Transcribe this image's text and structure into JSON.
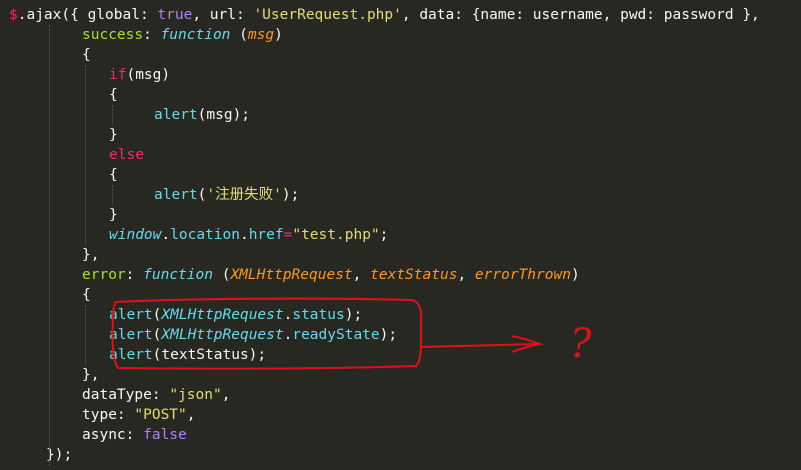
{
  "editor": {
    "lines": [
      {
        "indent": 0,
        "tokens": [
          {
            "t": "$",
            "c": "kw"
          },
          {
            "t": ".ajax({ global: ",
            "c": "pl"
          },
          {
            "t": "true",
            "c": "cn"
          },
          {
            "t": ", url: ",
            "c": "pl"
          },
          {
            "t": "'UserRequest.php'",
            "c": "st"
          },
          {
            "t": ", data: {name: username, pwd: password },",
            "c": "pl"
          }
        ]
      },
      {
        "indent": 1,
        "tokens": [
          {
            "t": "success",
            "c": "fn"
          },
          {
            "t": ": ",
            "c": "pl"
          },
          {
            "t": "function",
            "c": "kwi"
          },
          {
            "t": " (",
            "c": "pl"
          },
          {
            "t": "msg",
            "c": "pa"
          },
          {
            "t": ")",
            "c": "pl"
          }
        ]
      },
      {
        "indent": 1,
        "tokens": [
          {
            "t": "{",
            "c": "pl"
          }
        ]
      },
      {
        "indent": 2,
        "tokens": [
          {
            "t": "if",
            "c": "kw"
          },
          {
            "t": "(msg)",
            "c": "pl"
          }
        ]
      },
      {
        "indent": 2,
        "tokens": [
          {
            "t": "{",
            "c": "pl"
          }
        ]
      },
      {
        "indent": 3,
        "tokens": [
          {
            "t": "alert",
            "c": "ob"
          },
          {
            "t": "(msg);",
            "c": "pl"
          }
        ]
      },
      {
        "indent": 2,
        "tokens": [
          {
            "t": "}",
            "c": "pl"
          }
        ]
      },
      {
        "indent": 2,
        "tokens": [
          {
            "t": "else",
            "c": "kw"
          }
        ]
      },
      {
        "indent": 2,
        "tokens": [
          {
            "t": "{",
            "c": "pl"
          }
        ]
      },
      {
        "indent": 3,
        "tokens": [
          {
            "t": "alert",
            "c": "ob"
          },
          {
            "t": "(",
            "c": "pl"
          },
          {
            "t": "'注册失败'",
            "c": "st"
          },
          {
            "t": ");",
            "c": "pl"
          }
        ]
      },
      {
        "indent": 2,
        "tokens": [
          {
            "t": "}",
            "c": "pl"
          }
        ]
      },
      {
        "indent": 2,
        "tokens": [
          {
            "t": "window",
            "c": "id"
          },
          {
            "t": ".",
            "c": "pl"
          },
          {
            "t": "location",
            "c": "ob"
          },
          {
            "t": ".",
            "c": "pl"
          },
          {
            "t": "href",
            "c": "ob"
          },
          {
            "t": "=",
            "c": "kw"
          },
          {
            "t": "\"test.php\"",
            "c": "st"
          },
          {
            "t": ";",
            "c": "pl"
          }
        ]
      },
      {
        "indent": 1,
        "tokens": [
          {
            "t": "},",
            "c": "pl"
          }
        ]
      },
      {
        "indent": 1,
        "tokens": [
          {
            "t": "error",
            "c": "fn"
          },
          {
            "t": ": ",
            "c": "pl"
          },
          {
            "t": "function",
            "c": "kwi"
          },
          {
            "t": " (",
            "c": "pl"
          },
          {
            "t": "XMLHttpRequest",
            "c": "pa"
          },
          {
            "t": ", ",
            "c": "pl"
          },
          {
            "t": "textStatus",
            "c": "pa"
          },
          {
            "t": ", ",
            "c": "pl"
          },
          {
            "t": "errorThrown",
            "c": "pa"
          },
          {
            "t": ")",
            "c": "pl"
          }
        ]
      },
      {
        "indent": 1,
        "tokens": [
          {
            "t": "{",
            "c": "pl"
          }
        ]
      },
      {
        "indent": 2,
        "tokens": [
          {
            "t": "alert",
            "c": "ob"
          },
          {
            "t": "(",
            "c": "pl"
          },
          {
            "t": "XMLHttpRequest",
            "c": "id"
          },
          {
            "t": ".",
            "c": "pl"
          },
          {
            "t": "status",
            "c": "ob"
          },
          {
            "t": ");",
            "c": "pl"
          }
        ]
      },
      {
        "indent": 2,
        "tokens": [
          {
            "t": "alert",
            "c": "ob"
          },
          {
            "t": "(",
            "c": "pl"
          },
          {
            "t": "XMLHttpRequest",
            "c": "id"
          },
          {
            "t": ".",
            "c": "pl"
          },
          {
            "t": "readyState",
            "c": "ob"
          },
          {
            "t": ");",
            "c": "pl"
          }
        ]
      },
      {
        "indent": 2,
        "tokens": [
          {
            "t": "alert",
            "c": "ob"
          },
          {
            "t": "(textStatus);",
            "c": "pl"
          }
        ]
      },
      {
        "indent": 1,
        "tokens": [
          {
            "t": "},",
            "c": "pl"
          }
        ]
      },
      {
        "indent": 1,
        "tokens": [
          {
            "t": "dataType: ",
            "c": "pl"
          },
          {
            "t": "\"json\"",
            "c": "st"
          },
          {
            "t": ",",
            "c": "pl"
          }
        ]
      },
      {
        "indent": 1,
        "tokens": [
          {
            "t": "type: ",
            "c": "pl"
          },
          {
            "t": "\"POST\"",
            "c": "st"
          },
          {
            "t": ",",
            "c": "pl"
          }
        ]
      },
      {
        "indent": 1,
        "tokens": [
          {
            "t": "async: ",
            "c": "pl"
          },
          {
            "t": "false",
            "c": "cn"
          }
        ]
      },
      {
        "indent": 0.5,
        "tokens": [
          {
            "t": "});",
            "c": "pl"
          }
        ]
      }
    ]
  },
  "annotation": {
    "question_mark": "?",
    "color": "#e0101a"
  },
  "theme": {
    "background": "#272822",
    "foreground": "#f8f8f2"
  }
}
